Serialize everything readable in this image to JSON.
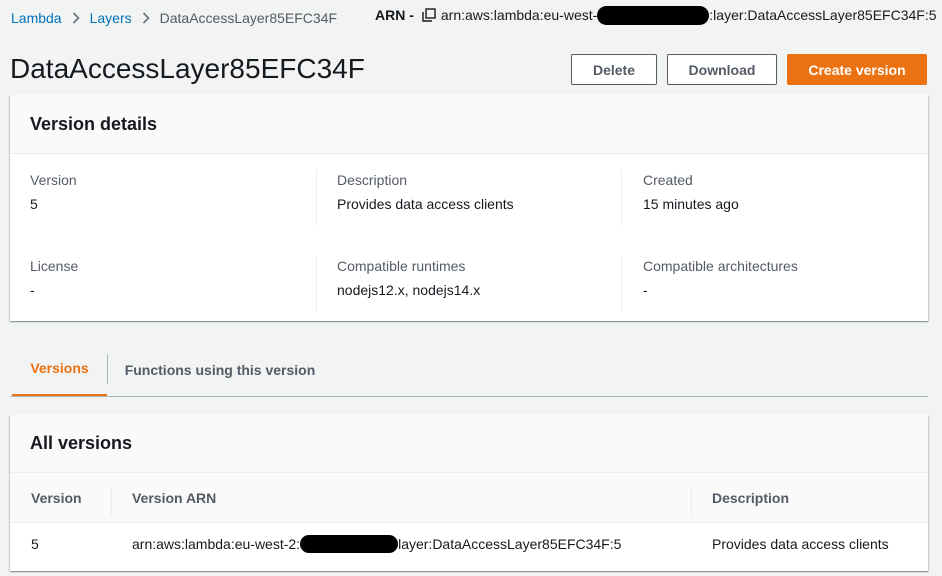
{
  "breadcrumb": {
    "items": [
      "Lambda",
      "Layers",
      "DataAccessLayer85EFC34F"
    ]
  },
  "arn": {
    "label": "ARN -",
    "prefix": "arn:aws:lambda:eu-west-",
    "suffix": ":layer:DataAccessLayer85EFC34F:5"
  },
  "page": {
    "title": "DataAccessLayer85EFC34F"
  },
  "actions": {
    "delete_label": "Delete",
    "download_label": "Download",
    "create_label": "Create version"
  },
  "version_details": {
    "heading": "Version details",
    "fields": [
      {
        "label": "Version",
        "value": "5"
      },
      {
        "label": "Description",
        "value": "Provides data access clients"
      },
      {
        "label": "Created",
        "value": "15 minutes ago"
      },
      {
        "label": "License",
        "value": "-"
      },
      {
        "label": "Compatible runtimes",
        "value": "nodejs12.x, nodejs14.x"
      },
      {
        "label": "Compatible architectures",
        "value": "-"
      }
    ]
  },
  "tabs": [
    {
      "label": "Versions",
      "active": true
    },
    {
      "label": "Functions using this version",
      "active": false
    }
  ],
  "all_versions": {
    "heading": "All versions",
    "columns": [
      "Version",
      "Version ARN",
      "Description"
    ],
    "rows": [
      {
        "version": "5",
        "arn_prefix": "arn:aws:lambda:eu-west-2:",
        "arn_suffix": "layer:DataAccessLayer85EFC34F:5",
        "description": "Provides data access clients"
      }
    ]
  },
  "colors": {
    "link": "#0073bb",
    "primary": "#ec7211",
    "background": "#f2f3f3"
  }
}
